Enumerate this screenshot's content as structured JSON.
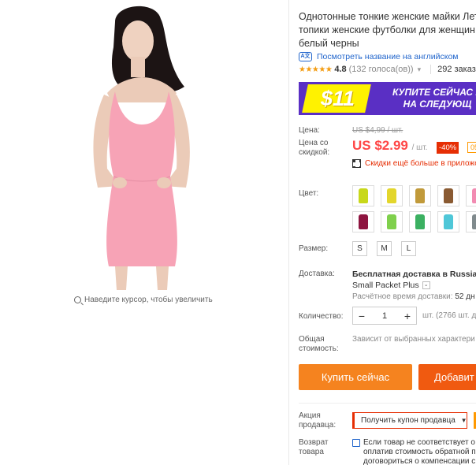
{
  "gallery": {
    "zoom_hint": "Наведите курсор, чтобы увеличить"
  },
  "product": {
    "title": "Однотонные тонкие женские майки Лет\nтопики женские футболки для женщин\nбелый черны",
    "translate_link": "Посмотреть название на английском",
    "rating": {
      "stars": "★★★★★",
      "value": "4.8",
      "votes": "(132 голоса(ов))",
      "orders": "292 заказа"
    }
  },
  "banner": {
    "price": "$11",
    "promo": "КУПИТЕ СЕЙЧАС И\nНА СЛЕДУЮЩ",
    "colors": {
      "bg": "#5a2fc4",
      "tag": "#fff200"
    }
  },
  "price": {
    "label": "Цена:",
    "old": "US $4,99 / шт.",
    "discount_label": "Цена со скидкой:",
    "new": "US $2.99",
    "per_unit": "/ шт.",
    "discount": "-40%",
    "coupon_tag": "05",
    "app_deal": "Скидки ещё больше в приложе"
  },
  "colors": {
    "label": "Цвет:",
    "swatches": [
      {
        "name": "swatch-yellow-green",
        "color": "#c8d81a"
      },
      {
        "name": "swatch-yellow",
        "color": "#e3d62c"
      },
      {
        "name": "swatch-mustard",
        "color": "#c19a3a"
      },
      {
        "name": "swatch-brown",
        "color": "#8a5a32"
      },
      {
        "name": "swatch-pink",
        "color": "#f28bb2"
      },
      {
        "name": "swatch-burgundy",
        "color": "#8e1540"
      },
      {
        "name": "swatch-lime",
        "color": "#7fd04c"
      },
      {
        "name": "swatch-green",
        "color": "#3bb061"
      },
      {
        "name": "swatch-cyan",
        "color": "#4fc7d8"
      },
      {
        "name": "swatch-gray",
        "color": "#808a8d"
      }
    ]
  },
  "sizes": {
    "label": "Размер:",
    "options": [
      "S",
      "M",
      "L"
    ]
  },
  "shipping": {
    "label": "Доставка:",
    "title": "Бесплатная доставка в Russian F",
    "method": "Small Packet Plus",
    "time_label": "Расчётное время доставки:",
    "time_value": "52 дн"
  },
  "quantity": {
    "label": "Количество:",
    "value": "1",
    "minus": "−",
    "plus": "+",
    "stock": "шт. (2766 шт. д"
  },
  "total": {
    "label": "Общая стоимость:",
    "note": "Зависит от выбранных характери"
  },
  "actions": {
    "buy_now": "Купить сейчас",
    "add_to_cart": "Добавит"
  },
  "seller_promo": {
    "label": "Акция продавца:",
    "coupon_button": "Получить купон продавца",
    "arrow": "▼"
  },
  "returns": {
    "label": "Возврат товара",
    "text": "Если товар не соответствует о\nоплатив стоимость обратной п\nдоговориться о компенсации с"
  }
}
